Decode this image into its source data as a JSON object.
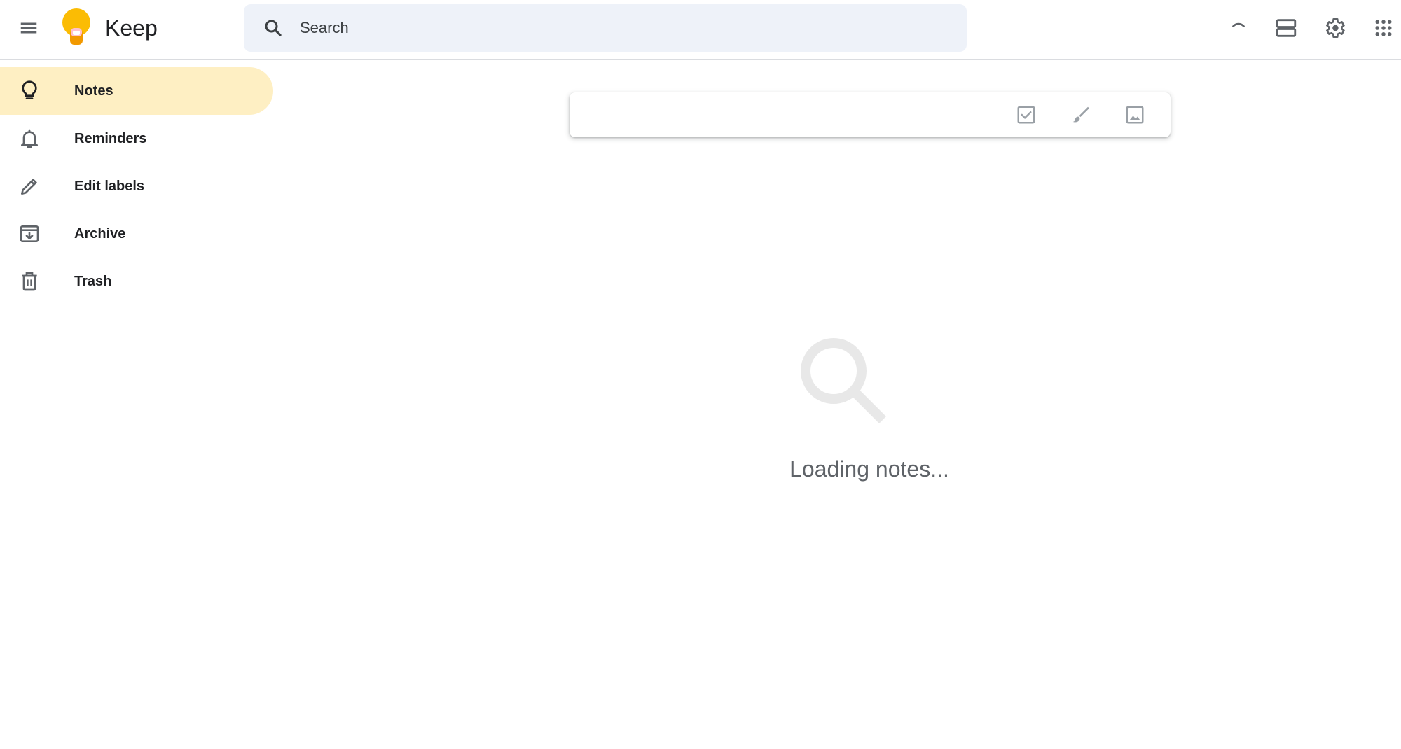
{
  "app": {
    "title": "Keep"
  },
  "search": {
    "placeholder": "Search"
  },
  "sidebar": {
    "items": [
      {
        "label": "Notes",
        "icon": "lightbulb-icon",
        "active": true
      },
      {
        "label": "Reminders",
        "icon": "bell-icon",
        "active": false
      },
      {
        "label": "Edit labels",
        "icon": "pencil-icon",
        "active": false
      },
      {
        "label": "Archive",
        "icon": "archive-icon",
        "active": false
      },
      {
        "label": "Trash",
        "icon": "trash-icon",
        "active": false
      }
    ]
  },
  "main": {
    "loading_text": "Loading notes..."
  },
  "colors": {
    "active_nav": "#feefc3",
    "search_bg": "#eef2f9",
    "icon_gray": "#5f6368"
  }
}
